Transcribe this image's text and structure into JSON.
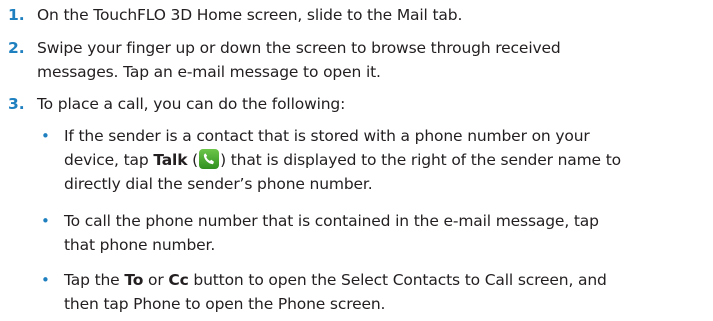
{
  "steps": [
    {
      "number": "1.",
      "text": "On the TouchFLO 3D Home screen, slide to the Mail tab."
    },
    {
      "number": "2.",
      "line1": "Swipe your finger up or down the screen to browse through received",
      "line2": "messages. Tap an e-mail message to open it."
    },
    {
      "number": "3.",
      "text": "To place a call, you can do the following:"
    }
  ],
  "bullets": [
    {
      "marker": "•",
      "line1": "If the sender is a contact that is stored with a phone number on your",
      "line2_a": "device, tap ",
      "line2_bold": "Talk",
      "line2_b": " (",
      "line2_c": ") that is displayed to the right of the sender name to",
      "line3": "directly dial the sender’s phone number.",
      "icon": "talk-phone-icon"
    },
    {
      "marker": "•",
      "line1": "To call the phone number that is contained in the e-mail message, tap",
      "line2": "that phone number."
    },
    {
      "marker": "•",
      "line1_a": "Tap the ",
      "line1_to": "To",
      "line1_or": " or ",
      "line1_cc": "Cc",
      "line1_b": " button to open the Select Contacts to Call screen, and",
      "line2": "then tap Phone to open the Phone screen."
    }
  ],
  "colors": {
    "accent": "#1f80c0",
    "text": "#231f20",
    "talk_icon": "#3fa52a"
  }
}
